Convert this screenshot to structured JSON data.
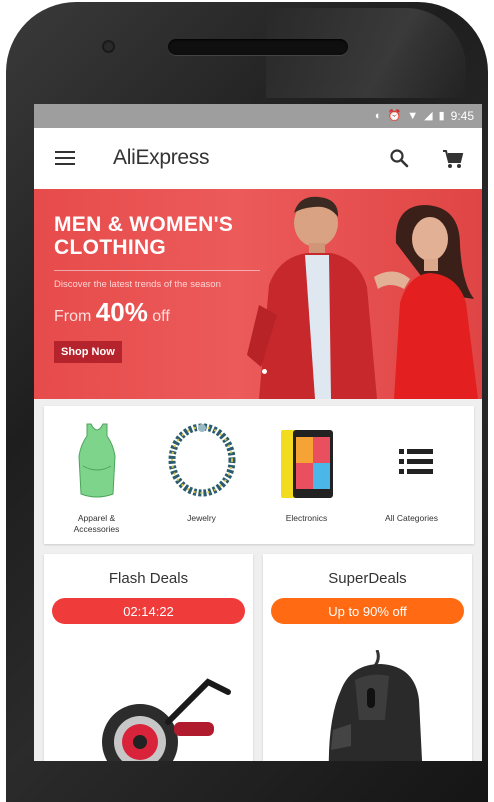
{
  "status_bar": {
    "time": "9:45",
    "icons": [
      "data-saver-icon",
      "alarm-icon",
      "wifi-icon",
      "signal-icon",
      "battery-icon"
    ]
  },
  "app_bar": {
    "title": "AliExpress",
    "icons": [
      "menu-icon",
      "search-icon",
      "cart-icon"
    ]
  },
  "banner": {
    "title_line1": "MEN & WOMEN'S",
    "title_line2": "CLOTHING",
    "subtitle": "Discover the latest trends of the season",
    "offer_prefix": "From",
    "offer_value": "40%",
    "offer_suffix": "off",
    "button_label": "Shop Now",
    "background_color": "#e74b4b",
    "button_color": "#b5242c"
  },
  "categories": [
    {
      "label_line1": "Apparel &",
      "label_line2": "Accessories",
      "icon": "tank-top-icon"
    },
    {
      "label_line1": "Jewelry",
      "label_line2": "",
      "icon": "necklace-icon"
    },
    {
      "label_line1": "Electronics",
      "label_line2": "",
      "icon": "smartphone-icon"
    },
    {
      "label_line1": "All Categories",
      "label_line2": "",
      "icon": "list-icon"
    }
  ],
  "deals": [
    {
      "title": "Flash Deals",
      "pill": "02:14:22",
      "pill_color": "#f03b3b",
      "image": "fishing-reel-icon"
    },
    {
      "title": "SuperDeals",
      "pill": "Up to 90% off",
      "pill_color": "#ff6a13",
      "image": "gaming-mouse-icon"
    }
  ]
}
